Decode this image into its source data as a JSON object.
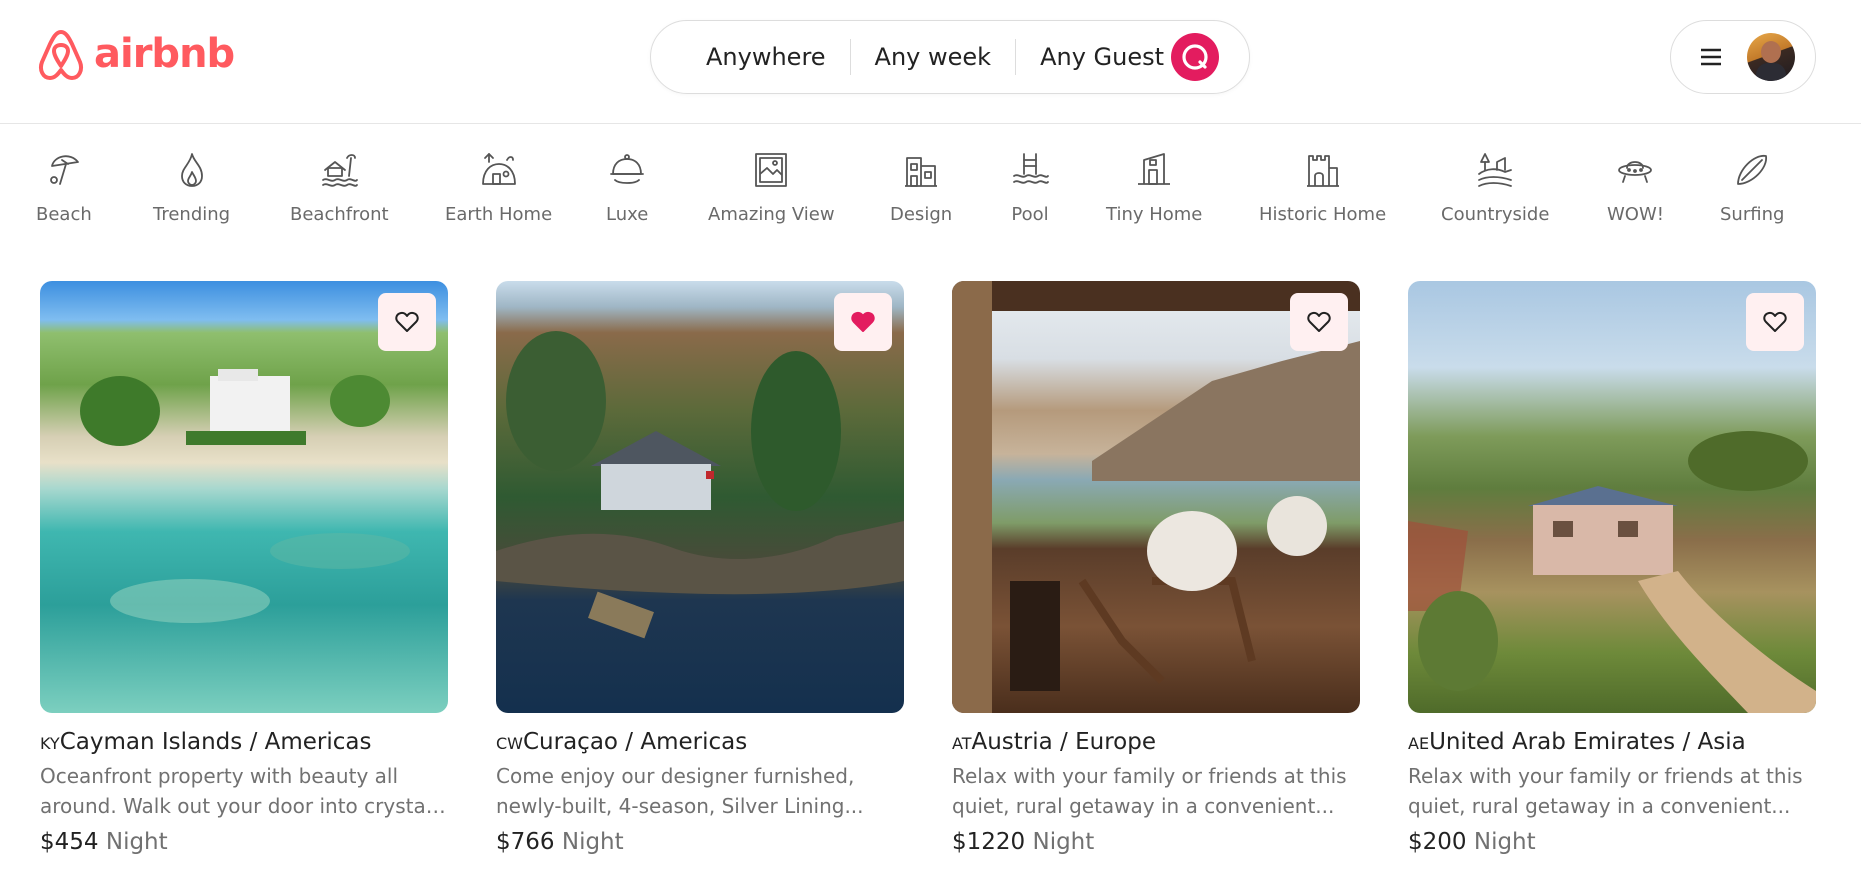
{
  "header": {
    "logo_text": "airbnb",
    "brand_color": "#ff5a5f",
    "search": {
      "location": "Anywhere",
      "dates": "Any week",
      "guests": "Any Guest",
      "button_color": "#e31c5f"
    },
    "user_menu": {
      "menu_icon": "hamburger-icon",
      "avatar": "user-avatar"
    }
  },
  "categories": [
    {
      "label": "Beach",
      "icon": "beach-umbrella-icon"
    },
    {
      "label": "Trending",
      "icon": "flame-icon"
    },
    {
      "label": "Beachfront",
      "icon": "beachfront-icon"
    },
    {
      "label": "Earth Home",
      "icon": "earth-home-icon"
    },
    {
      "label": "Luxe",
      "icon": "luxe-cloche-icon"
    },
    {
      "label": "Amazing View",
      "icon": "amazing-view-icon"
    },
    {
      "label": "Design",
      "icon": "design-building-icon"
    },
    {
      "label": "Pool",
      "icon": "pool-icon"
    },
    {
      "label": "Tiny Home",
      "icon": "tiny-home-icon"
    },
    {
      "label": "Historic Home",
      "icon": "historic-home-icon"
    },
    {
      "label": "Countryside",
      "icon": "countryside-icon"
    },
    {
      "label": "WOW!",
      "icon": "ufo-icon"
    },
    {
      "label": "Surfing",
      "icon": "surfboard-icon"
    }
  ],
  "listings": [
    {
      "code": "KY",
      "title": "Cayman Islands / Americas",
      "desc_line1": "Oceanfront property with beauty all",
      "desc_line2": "around. Walk out your door into crystal...",
      "price": "$454",
      "unit": "Night",
      "favorited": false,
      "image": "aerial-beach-house"
    },
    {
      "code": "CW",
      "title": "Curaçao / Americas",
      "desc_line1": "Come enjoy our designer furnished,",
      "desc_line2": "newly-built, 4-season, Silver Lining...",
      "price": "$766",
      "unit": "Night",
      "favorited": true,
      "image": "island-cabin"
    },
    {
      "code": "AT",
      "title": "Austria / Europe",
      "desc_line1": "Relax with your family or friends at this",
      "desc_line2": "quiet, rural getaway in a convenient...",
      "price": "$1220",
      "unit": "Night",
      "favorited": false,
      "image": "terrace-lake-view"
    },
    {
      "code": "AE",
      "title": "United Arab Emirates / Asia",
      "desc_line1": "Relax with your family or friends at this",
      "desc_line2": "quiet, rural getaway in a convenient...",
      "price": "$200",
      "unit": "Night",
      "favorited": false,
      "image": "countryside-villa"
    }
  ]
}
